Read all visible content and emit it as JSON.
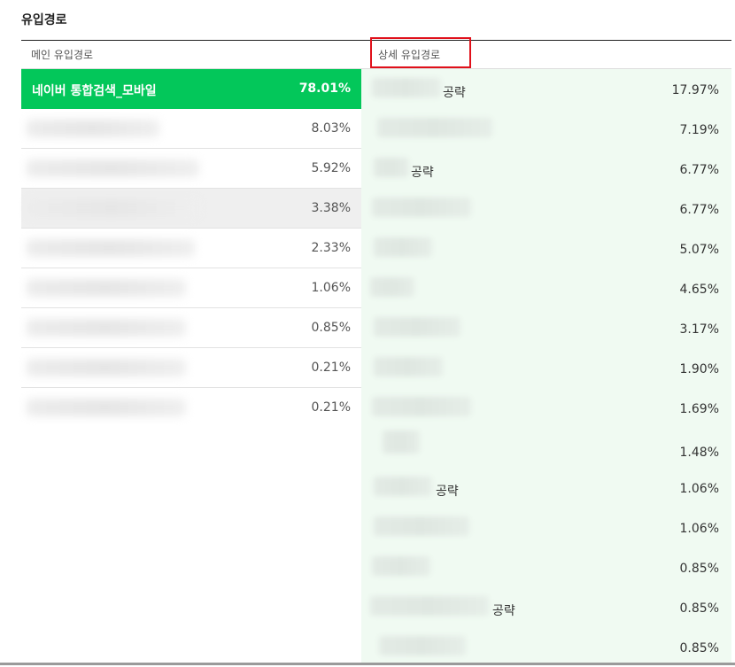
{
  "section": {
    "title": "유입경로"
  },
  "columns": {
    "main": "메인 유입경로",
    "detail": "상세 유입경로"
  },
  "main_rows": [
    {
      "name": "네이버 통합검색_모바일",
      "pct": "78.01%"
    },
    {
      "name": "",
      "pct": "8.03%"
    },
    {
      "name": "",
      "pct": "5.92%"
    },
    {
      "name": "",
      "pct": "3.38%"
    },
    {
      "name": "",
      "pct": "2.33%"
    },
    {
      "name": "",
      "pct": "1.06%"
    },
    {
      "name": "",
      "pct": "0.85%"
    },
    {
      "name": "",
      "pct": "0.21%"
    },
    {
      "name": "",
      "pct": "0.21%"
    }
  ],
  "detail_rows": [
    {
      "suffix": "공략",
      "pct": "17.97%"
    },
    {
      "suffix": "",
      "pct": "7.19%"
    },
    {
      "suffix": "공략",
      "pct": "6.77%"
    },
    {
      "suffix": "",
      "pct": "6.77%"
    },
    {
      "suffix": "",
      "pct": "5.07%"
    },
    {
      "suffix": "",
      "pct": "4.65%"
    },
    {
      "suffix": "",
      "pct": "3.17%"
    },
    {
      "suffix": "",
      "pct": "1.90%"
    },
    {
      "suffix": "",
      "pct": "1.69%"
    },
    {
      "suffix": "",
      "pct": "1.48%"
    },
    {
      "suffix": "공략",
      "pct": "1.06%"
    },
    {
      "suffix": "",
      "pct": "1.06%"
    },
    {
      "suffix": "",
      "pct": "0.85%"
    },
    {
      "suffix": "공략",
      "pct": "0.85%"
    },
    {
      "suffix": "",
      "pct": "0.85%"
    }
  ],
  "colors": {
    "accent": "#03c75a",
    "detail_bg": "#f0faf2",
    "highlight_box": "#e0101a"
  }
}
